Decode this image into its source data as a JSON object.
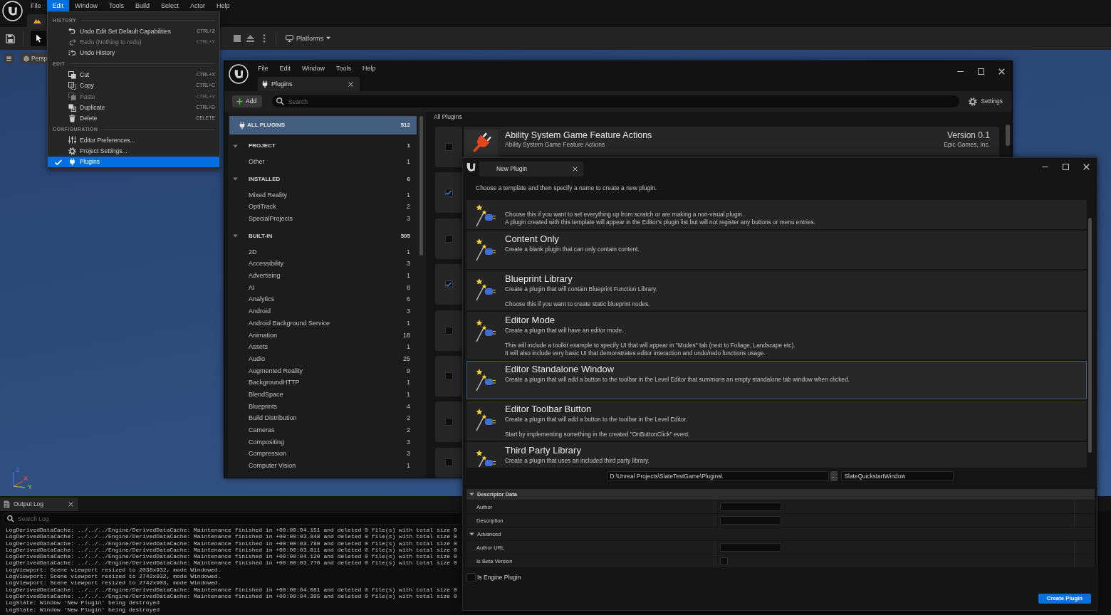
{
  "editor": {
    "menu_bar": [
      {
        "label": "File",
        "selected": false
      },
      {
        "label": "Edit",
        "selected": true
      },
      {
        "label": "Window",
        "selected": false
      },
      {
        "label": "Tools",
        "selected": false
      },
      {
        "label": "Build",
        "selected": false
      },
      {
        "label": "Select",
        "selected": false
      },
      {
        "label": "Actor",
        "selected": false
      },
      {
        "label": "Help",
        "selected": false
      }
    ],
    "platforms_button": "Platforms",
    "viewport_button": "Persp",
    "axes": [
      {
        "label": "Z",
        "color": "#3d6fd6"
      },
      {
        "label": "X",
        "color": "#d2553a"
      },
      {
        "label": "Y",
        "color": "#7fb04a"
      }
    ],
    "output_log": {
      "tab": "Output Log",
      "search": {
        "placeholder": "Search Log"
      },
      "lines": [
        "LogDerivedDataCache: ../../../Engine/DerivedDataCache: Maintenance finished in +00:00:04.151 and deleted 0 file(s) with total size 0",
        "LogDerivedDataCache: ../../../Engine/DerivedDataCache: Maintenance finished in +00:00:03.848 and deleted 0 file(s) with total size 0",
        "LogDerivedDataCache: ../../../Engine/DerivedDataCache: Maintenance finished in +00:00:03.780 and deleted 0 file(s) with total size 0",
        "LogDerivedDataCache: ../../../Engine/DerivedDataCache: Maintenance finished in +00:00:03.811 and deleted 0 file(s) with total size 0",
        "LogDerivedDataCache: ../../../Engine/DerivedDataCache: Maintenance finished in +00:00:04.120 and deleted 0 file(s) with total size 0",
        "LogDerivedDataCache: ../../../Engine/DerivedDataCache: Maintenance finished in +00:00:03.770 and deleted 0 file(s) with total size 0",
        "LogViewport: Scene viewport resized to 2038x932, mode Windowed.",
        "LogViewport: Scene viewport resized to 2742x932, mode Windowed.",
        "LogViewport: Scene viewport resized to 2742x903, mode Windowed.",
        "LogDerivedDataCache: ../../../Engine/DerivedDataCache: Maintenance finished in +00:00:04.081 and deleted 0 file(s) with total size 0",
        "LogDerivedDataCache: ../../../Engine/DerivedDataCache: Maintenance finished in +00:00:04.395 and deleted 0 file(s) with total size 0",
        "LogSlate: Window 'New Plugin' being destroyed",
        "LogSlate: Window 'New Plugin' being destroyed"
      ]
    }
  },
  "edit_menu": {
    "sections": [
      {
        "heading": "HISTORY",
        "items": [
          {
            "kind": "undo",
            "label": "Undo Edit Set Default Capabilities",
            "shortcut": "CTRL+Z",
            "disabled": false,
            "checked": false,
            "selected": false
          },
          {
            "kind": "redo",
            "label": "Redo (Nothing to redo)",
            "shortcut": "CTRL+Y",
            "disabled": true,
            "checked": false,
            "selected": false
          },
          {
            "kind": "history",
            "label": "Undo History",
            "disabled": false,
            "checked": false,
            "selected": false
          }
        ]
      },
      {
        "heading": "EDIT",
        "items": [
          {
            "kind": "cut",
            "label": "Cut",
            "shortcut": "CTRL+X",
            "disabled": false,
            "checked": false,
            "selected": false
          },
          {
            "kind": "copy",
            "label": "Copy",
            "shortcut": "CTRL+C",
            "disabled": false,
            "checked": false,
            "selected": false
          },
          {
            "kind": "paste",
            "label": "Paste",
            "shortcut": "CTRL+V",
            "disabled": true,
            "checked": false,
            "selected": false
          },
          {
            "kind": "duplicate",
            "label": "Duplicate",
            "shortcut": "CTRL+D",
            "disabled": false,
            "checked": false,
            "selected": false
          },
          {
            "kind": "delete",
            "label": "Delete",
            "shortcut": "DELETE",
            "disabled": false,
            "checked": false,
            "selected": false
          }
        ]
      },
      {
        "heading": "CONFIGURATION",
        "items": [
          {
            "kind": "preferences",
            "label": "Editor Preferences...",
            "disabled": false,
            "checked": false,
            "selected": false
          },
          {
            "kind": "settings",
            "label": "Project Settings...",
            "disabled": false,
            "checked": false,
            "selected": false
          },
          {
            "kind": "plugins",
            "label": "Plugins",
            "disabled": false,
            "checked": true,
            "selected": true
          }
        ]
      }
    ]
  },
  "plugins_window": {
    "menu": [
      "File",
      "Edit",
      "Window",
      "Tools",
      "Help"
    ],
    "tab": "Plugins",
    "add_button": "Add",
    "search": {
      "placeholder": "Search"
    },
    "settings_button": "Settings",
    "categories": {
      "all": {
        "label": "ALL PLUGINS",
        "count": "512",
        "selected": true
      },
      "groups": [
        {
          "label": "PROJECT",
          "count": "1",
          "expanded": true,
          "selected": false,
          "children": [
            {
              "label": "Other",
              "count": "1",
              "selected": false
            }
          ]
        },
        {
          "label": "INSTALLED",
          "count": "6",
          "expanded": true,
          "selected": false,
          "children": [
            {
              "label": "Mixed Reality",
              "count": "1",
              "selected": false
            },
            {
              "label": "OptiTrack",
              "count": "2",
              "selected": false
            },
            {
              "label": "SpecialProjects",
              "count": "3",
              "selected": false
            }
          ]
        },
        {
          "label": "BUILT-IN",
          "count": "505",
          "expanded": true,
          "selected": false,
          "children": [
            {
              "label": "2D",
              "count": "1",
              "selected": false
            },
            {
              "label": "Accessibility",
              "count": "3",
              "selected": false
            },
            {
              "label": "Advertising",
              "count": "1",
              "selected": false
            },
            {
              "label": "AI",
              "count": "8",
              "selected": false
            },
            {
              "label": "Analytics",
              "count": "6",
              "selected": false
            },
            {
              "label": "Android",
              "count": "3",
              "selected": false
            },
            {
              "label": "Android Background Service",
              "count": "1",
              "selected": false
            },
            {
              "label": "Animation",
              "count": "18",
              "selected": false
            },
            {
              "label": "Assets",
              "count": "1",
              "selected": false
            },
            {
              "label": "Audio",
              "count": "25",
              "selected": false
            },
            {
              "label": "Augmented Reality",
              "count": "9",
              "selected": false
            },
            {
              "label": "BackgroundHTTP",
              "count": "1",
              "selected": false
            },
            {
              "label": "BlendSpace",
              "count": "1",
              "selected": false
            },
            {
              "label": "Blueprints",
              "count": "4",
              "selected": false
            },
            {
              "label": "Build Distribution",
              "count": "2",
              "selected": false
            },
            {
              "label": "Cameras",
              "count": "2",
              "selected": false
            },
            {
              "label": "Compositing",
              "count": "3",
              "selected": false
            },
            {
              "label": "Compression",
              "count": "3",
              "selected": false
            },
            {
              "label": "Computer Vision",
              "count": "1",
              "selected": false
            }
          ]
        }
      ]
    },
    "list_heading": "All Plugins",
    "plugins": [
      {
        "name": "Ability System Game Feature Actions",
        "description": "Ability System Game Feature Actions",
        "version": "Version 0.1",
        "author": "Epic Games, Inc.",
        "enabled": false
      },
      {
        "enabled": true
      },
      {
        "enabled": false
      },
      {
        "enabled": true
      },
      {
        "enabled": false
      },
      {
        "enabled": false
      },
      {
        "enabled": false
      },
      {
        "enabled": false
      }
    ]
  },
  "new_plugin_window": {
    "tab": "New Plugin",
    "instructions": "Choose a template and then specify a name to create a new plugin.",
    "templates": [
      {
        "details": [
          "Choose this if you want to set everything up from scratch or are making a non-visual plugin.",
          "A plugin created with this template will appear in the Editor's plugin list but will not register any buttons or menu entries."
        ],
        "selected": false
      },
      {
        "title": "Content Only",
        "description": "Create a blank plugin that can only contain content.",
        "selected": false
      },
      {
        "title": "Blueprint Library",
        "description": "Create a plugin that will contain Blueprint Function Library.",
        "details": [
          "Choose this if you want to create static blueprint nodes."
        ],
        "selected": false
      },
      {
        "title": "Editor Mode",
        "description": "Create a plugin that will have an editor mode.",
        "details": [
          "This will include a toolkit example to specify UI that will appear in \"Modes\" tab (next to Foliage, Landscape etc).",
          "It will also include very basic UI that demonstrates editor interaction and undo/redo functions usage."
        ],
        "selected": false
      },
      {
        "title": "Editor Standalone Window",
        "description": "Create a plugin that will add a button to the toolbar in the Level Editor that summons an empty standalone tab window when clicked.",
        "selected": true
      },
      {
        "title": "Editor Toolbar Button",
        "description": "Create a plugin that will add a button to the toolbar in the Level Editor.",
        "details": [
          "Start by implementing something in the created \"OnButtonClick\" event."
        ],
        "selected": false
      },
      {
        "title": "Third Party Library",
        "description": "Create a plugin that uses an included third party library.",
        "selected": false
      }
    ],
    "path": {
      "folder": "D:\\Unreal Projects\\SlateTestGame\\Plugins\\",
      "browse_button": "...",
      "name": "SlateQuickstartWindow"
    },
    "descriptor": {
      "title": "Descriptor Data",
      "expanded": true,
      "rows": [
        {
          "kind": "text",
          "label": "Author"
        },
        {
          "kind": "text",
          "label": "Description"
        },
        {
          "kind": "group",
          "label": "Advanced",
          "expanded": true,
          "children": [
            {
              "kind": "text",
              "label": "Author URL"
            },
            {
              "kind": "checkbox",
              "label": "Is Beta Version",
              "checked": false
            }
          ]
        }
      ]
    },
    "engine_plugin": {
      "label": "Is Engine Plugin",
      "checked": false
    },
    "create_button": "Create Plugin"
  }
}
